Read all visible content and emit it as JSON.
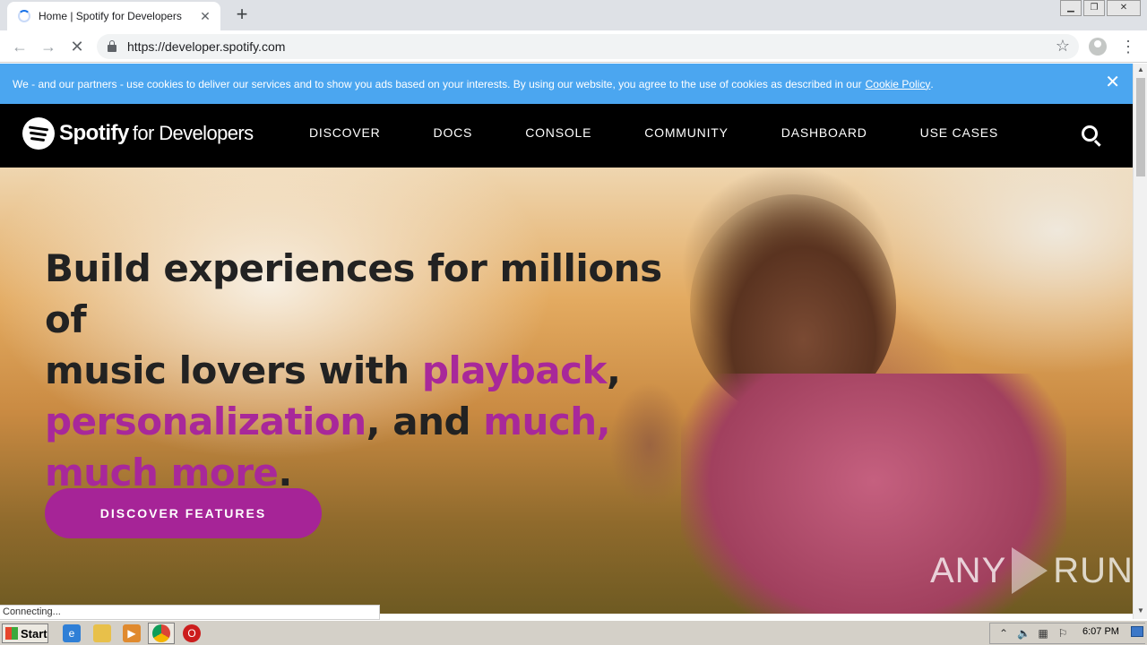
{
  "browser": {
    "tab_title": "Home | Spotify for Developers",
    "new_tab_label": "+",
    "url": "https://developer.spotify.com",
    "status_text": "Connecting..."
  },
  "cookie_banner": {
    "text": "We - and our partners - use cookies to deliver our services and to show you ads based on your interests. By using our website, you agree to the use of cookies as described in our",
    "link": "Cookie Policy",
    "period": "."
  },
  "site": {
    "logo_brand": "Spotify",
    "logo_suffix": "for Developers",
    "nav": [
      {
        "label": "DISCOVER"
      },
      {
        "label": "DOCS"
      },
      {
        "label": "CONSOLE"
      },
      {
        "label": "COMMUNITY"
      },
      {
        "label": "DASHBOARD"
      },
      {
        "label": "USE CASES"
      }
    ]
  },
  "hero": {
    "line1": "Build experiences for millions of",
    "line2a": "music lovers with ",
    "line2b": "playback",
    "line2c": ",",
    "line3a": "personalization",
    "line3b": ", and ",
    "line3c": "much,",
    "line4a": "much more",
    "line4b": ".",
    "cta": "DISCOVER FEATURES"
  },
  "watermark": {
    "left": "ANY",
    "right": "RUN"
  },
  "taskbar": {
    "start": "Start",
    "clock": "6:07 PM"
  },
  "colors": {
    "accent_magenta": "#a8289a",
    "cookie_blue": "#4ba6f0",
    "nav_black": "#000000"
  }
}
